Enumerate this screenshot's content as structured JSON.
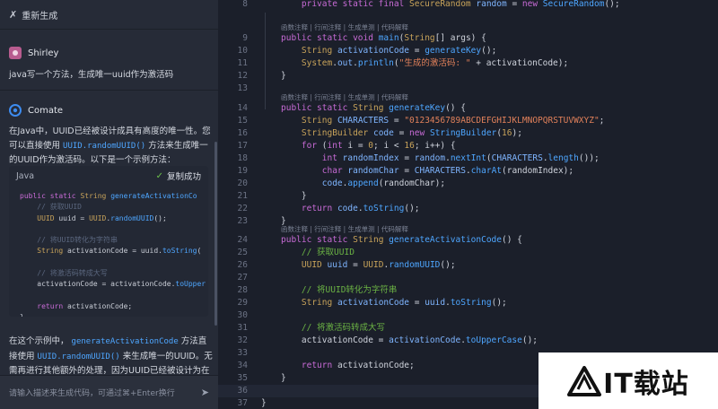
{
  "chat": {
    "regenerate_label": "重新生成",
    "user": {
      "name": "Shirley",
      "message": "java写一个方法，生成唯一uuid作为激活码"
    },
    "bot": {
      "name": "Comate",
      "intro_1": "在Java中，UUID已经被设计成具有高度的唯一性。您可以直接使用",
      "intro_code": "UUID.randomUUID()",
      "intro_2": "方法来生成唯一的UUID作为激活码。以下是一个示例方法：",
      "code_lang": "Java",
      "copy_label": "复制成功",
      "after_1": "在这个示例中，",
      "after_code_1": "generateActivationCode",
      "after_2": "方法直接使用",
      "after_code_2": "UUID.randomUUID()",
      "after_3": "来生成唯一的UUID。无需再进行其他额外的处理，因为UUID已经被设计为在很大程度上"
    },
    "input_placeholder": "请输入描述来生成代码，可通过⌘+Enter换行"
  },
  "editor": {
    "lens_label": "函数注释 | 行间注释 | 生成单测 | 代码解释",
    "line_numbers": [
      "8",
      "9",
      "10",
      "11",
      "12",
      "13",
      "14",
      "15",
      "16",
      "17",
      "18",
      "19",
      "20",
      "21",
      "22",
      "23",
      "24",
      "25",
      "26",
      "27",
      "28",
      "29",
      "30",
      "31",
      "32",
      "33",
      "34",
      "35",
      "36",
      "37"
    ]
  },
  "watermark": {
    "text": "IT载站"
  },
  "colors": {
    "keyword": "#c86bd6",
    "type": "#c8a35a",
    "function": "#4ea6ff",
    "string": "#e0805a",
    "comment": "#6bb344"
  }
}
